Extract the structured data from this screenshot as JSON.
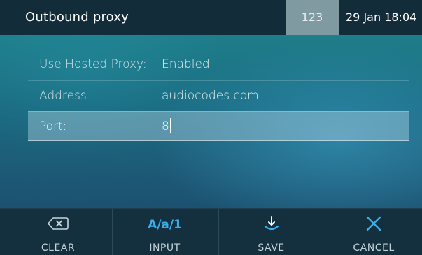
{
  "header": {
    "title": "Outbound proxy",
    "input_mode": "123",
    "datetime": "29 Jan 18:04"
  },
  "fields": [
    {
      "label": "Use Hosted Proxy:",
      "value": "Enabled"
    },
    {
      "label": "Address:",
      "value": "audiocodes.com"
    },
    {
      "label": "Port:",
      "value": "8"
    }
  ],
  "softkeys": {
    "clear": {
      "label": "CLEAR",
      "icon": "backspace-icon"
    },
    "input": {
      "label": "INPUT",
      "icon": "input-mode-icon",
      "icon_text": "A/a/1"
    },
    "save": {
      "label": "SAVE",
      "icon": "save-icon"
    },
    "cancel": {
      "label": "CANCEL",
      "icon": "close-icon"
    }
  },
  "colors": {
    "accent": "#3aaee8",
    "header_bg": "#132c3a",
    "mode_bg": "#7f9aa1"
  }
}
